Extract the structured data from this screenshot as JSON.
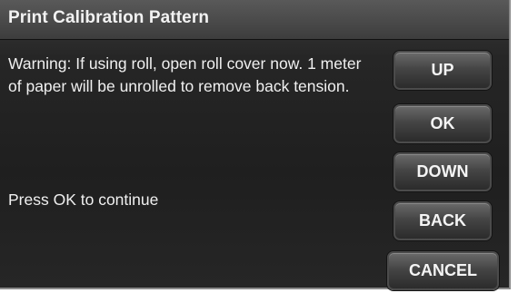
{
  "dialog": {
    "title": "Print Calibration Pattern",
    "message": "Warning: If using roll, open roll cover now. 1 meter of paper will be unrolled to remove back tension.",
    "prompt": "Press OK to continue"
  },
  "buttons": {
    "up": "UP",
    "ok": "OK",
    "down": "DOWN",
    "back": "BACK",
    "cancel": "CANCEL"
  }
}
